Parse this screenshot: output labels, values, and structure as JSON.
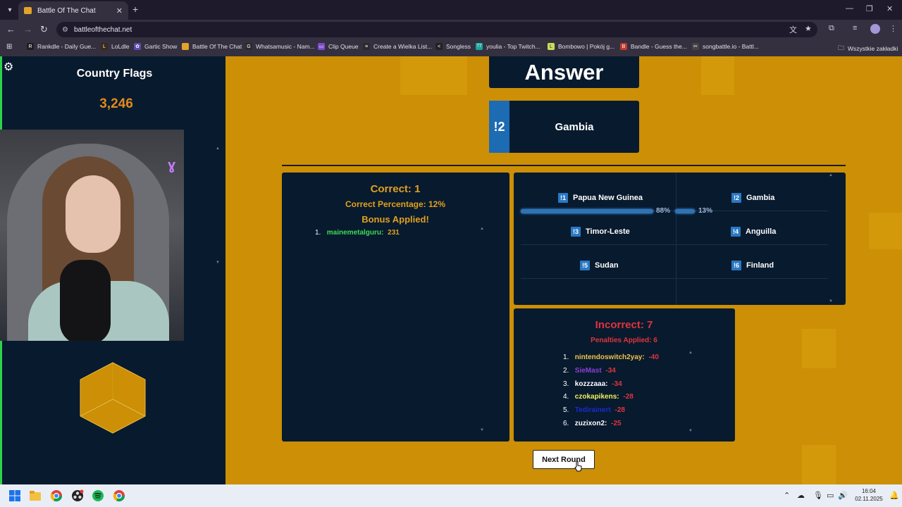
{
  "browser": {
    "tab_title": "Battle Of The Chat",
    "url": "battleofthechat.net",
    "bookmarks": [
      {
        "label": "Rankdle - Daily Gue...",
        "color": "#1e1e1e",
        "glyph": "R"
      },
      {
        "label": "LoLdle",
        "color": "#3a2a1a",
        "glyph": "L"
      },
      {
        "label": "Gartic Show",
        "color": "#5b4bb0",
        "glyph": "✿"
      },
      {
        "label": "Battle Of The Chat",
        "color": "#e2a32a",
        "glyph": ""
      },
      {
        "label": "Whatsamusic - Nam...",
        "color": "#2b2b2b",
        "glyph": "G"
      },
      {
        "label": "Clip Queue",
        "color": "#7a4cc9",
        "glyph": "▭"
      },
      {
        "label": "Create a Wielka List...",
        "color": "#2b2b2b",
        "glyph": "≡"
      },
      {
        "label": "Songless",
        "color": "#222",
        "glyph": "<"
      },
      {
        "label": "youlia - Top Twitch...",
        "color": "#1aa39a",
        "glyph": "TT"
      },
      {
        "label": "Bombowo | Pokój g...",
        "color": "#c8e05a",
        "glyph": "L"
      },
      {
        "label": "Bandle - Guess the...",
        "color": "#c0392b",
        "glyph": "B"
      },
      {
        "label": "songbattle.io - Battl...",
        "color": "#444",
        "glyph": "✂"
      }
    ],
    "all_bookmarks": "Wszystkie zakładki"
  },
  "left_panel": {
    "title": "Country Flags",
    "score": "3,246"
  },
  "answer": {
    "heading": "Answer",
    "number": "!2",
    "country": "Gambia"
  },
  "correct": {
    "title": "Correct: 1",
    "percentage": "Correct Percentage: 12%",
    "bonus": "Bonus Applied!",
    "entries": [
      {
        "index": "1.",
        "name": "mainemetalguru:",
        "points": "231",
        "color": "#3ddc56"
      }
    ]
  },
  "options": [
    {
      "badge": "!1",
      "label": "Papua New Guinea",
      "percent": "88%",
      "fraction": 0.88
    },
    {
      "badge": "!2",
      "label": "Gambia",
      "percent": "13%",
      "fraction": 0.13
    },
    {
      "badge": "!3",
      "label": "Timor-Leste"
    },
    {
      "badge": "!4",
      "label": "Anguilla"
    },
    {
      "badge": "!5",
      "label": "Sudan"
    },
    {
      "badge": "!6",
      "label": "Finland"
    }
  ],
  "incorrect": {
    "title": "Incorrect: 7",
    "penalties": "Penalties Applied: 6",
    "entries": [
      {
        "index": "1.",
        "name": "nintendoswitch2yay:",
        "points": "-40",
        "color": "#f0c24a"
      },
      {
        "index": "2.",
        "name": "SieMast",
        "points": "-34",
        "color": "#8b3fd6"
      },
      {
        "index": "3.",
        "name": "kozzzaaa:",
        "points": "-34",
        "color": "#ffffff"
      },
      {
        "index": "4.",
        "name": "czokapikens:",
        "points": "-28",
        "color": "#f2f25a"
      },
      {
        "index": "5.",
        "name": "Tedirainert",
        "points": "-28",
        "color": "#1a2ad0"
      },
      {
        "index": "6.",
        "name": "zuzixon2:",
        "points": "-25",
        "color": "#ffffff"
      }
    ]
  },
  "next_button": "Next Round",
  "taskbar": {
    "time": "16:04",
    "date": "02.11.2025"
  }
}
